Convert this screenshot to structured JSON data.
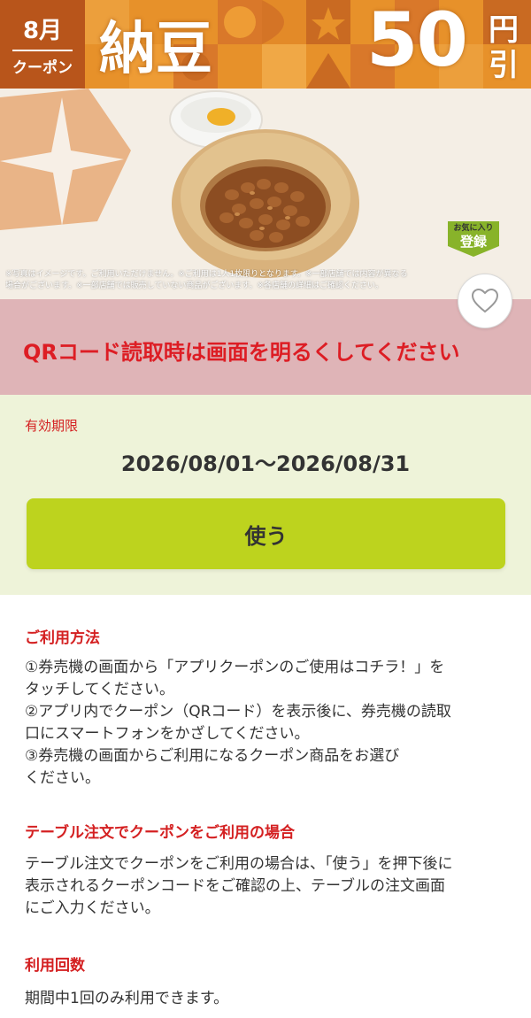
{
  "banner": {
    "month": "8月",
    "month_sub": "クーポン",
    "product_name": "納豆",
    "discount_amount": "50",
    "discount_unit_top": "円",
    "discount_unit_bottom": "引"
  },
  "hero": {
    "favorite_tag_line1": "お気に入り",
    "favorite_tag_line2": "登録",
    "disclaimer_line1": "※写真はイメージです。ご利用いただけません。※ご利用は1人1枚限りとなります。※一部店舗では内容が異なる",
    "disclaimer_line2": "場合がございます。※一部店舗では販売していない商品がございます。※各店舗の詳細はご確認ください。"
  },
  "icons": {
    "favorite": "heart-icon"
  },
  "notice": {
    "text": "QRコード読取時は画面を明るくしてください"
  },
  "validity": {
    "label": "有効期限",
    "range": "2026/08/01～2026/08/31"
  },
  "actions": {
    "use_label": "使う"
  },
  "usage": {
    "title": "ご利用方法",
    "lines": [
      "①券売機の画面から「アプリクーポンのご使用はコチラ！」を",
      "タッチしてください。",
      "②アプリ内でクーポン（QRコード）を表示後に、券売機の読取",
      "口にスマートフォンをかざしてください。",
      "③券売機の画面からご利用になるクーポン商品をお選び",
      "ください。"
    ]
  },
  "table_order": {
    "title": "テーブル注文でクーポンをご利用の場合",
    "lines": [
      "テーブル注文でクーポンをご利用の場合は、「使う」を押下後に",
      "表示されるクーポンコードをご確認の上、テーブルの注文画面",
      "にご入力ください。"
    ]
  },
  "usage_count": {
    "title": "利用回数",
    "text": "期間中1回のみ利用できます。"
  },
  "colors": {
    "banner_orange": "#e7912a",
    "badge_brown": "#b8551b",
    "notice_bg": "#dfb4b7",
    "notice_red": "#dd1d24",
    "validity_bg": "#eef3d9",
    "button_green": "#bdd31e",
    "section_red": "#d42021"
  }
}
